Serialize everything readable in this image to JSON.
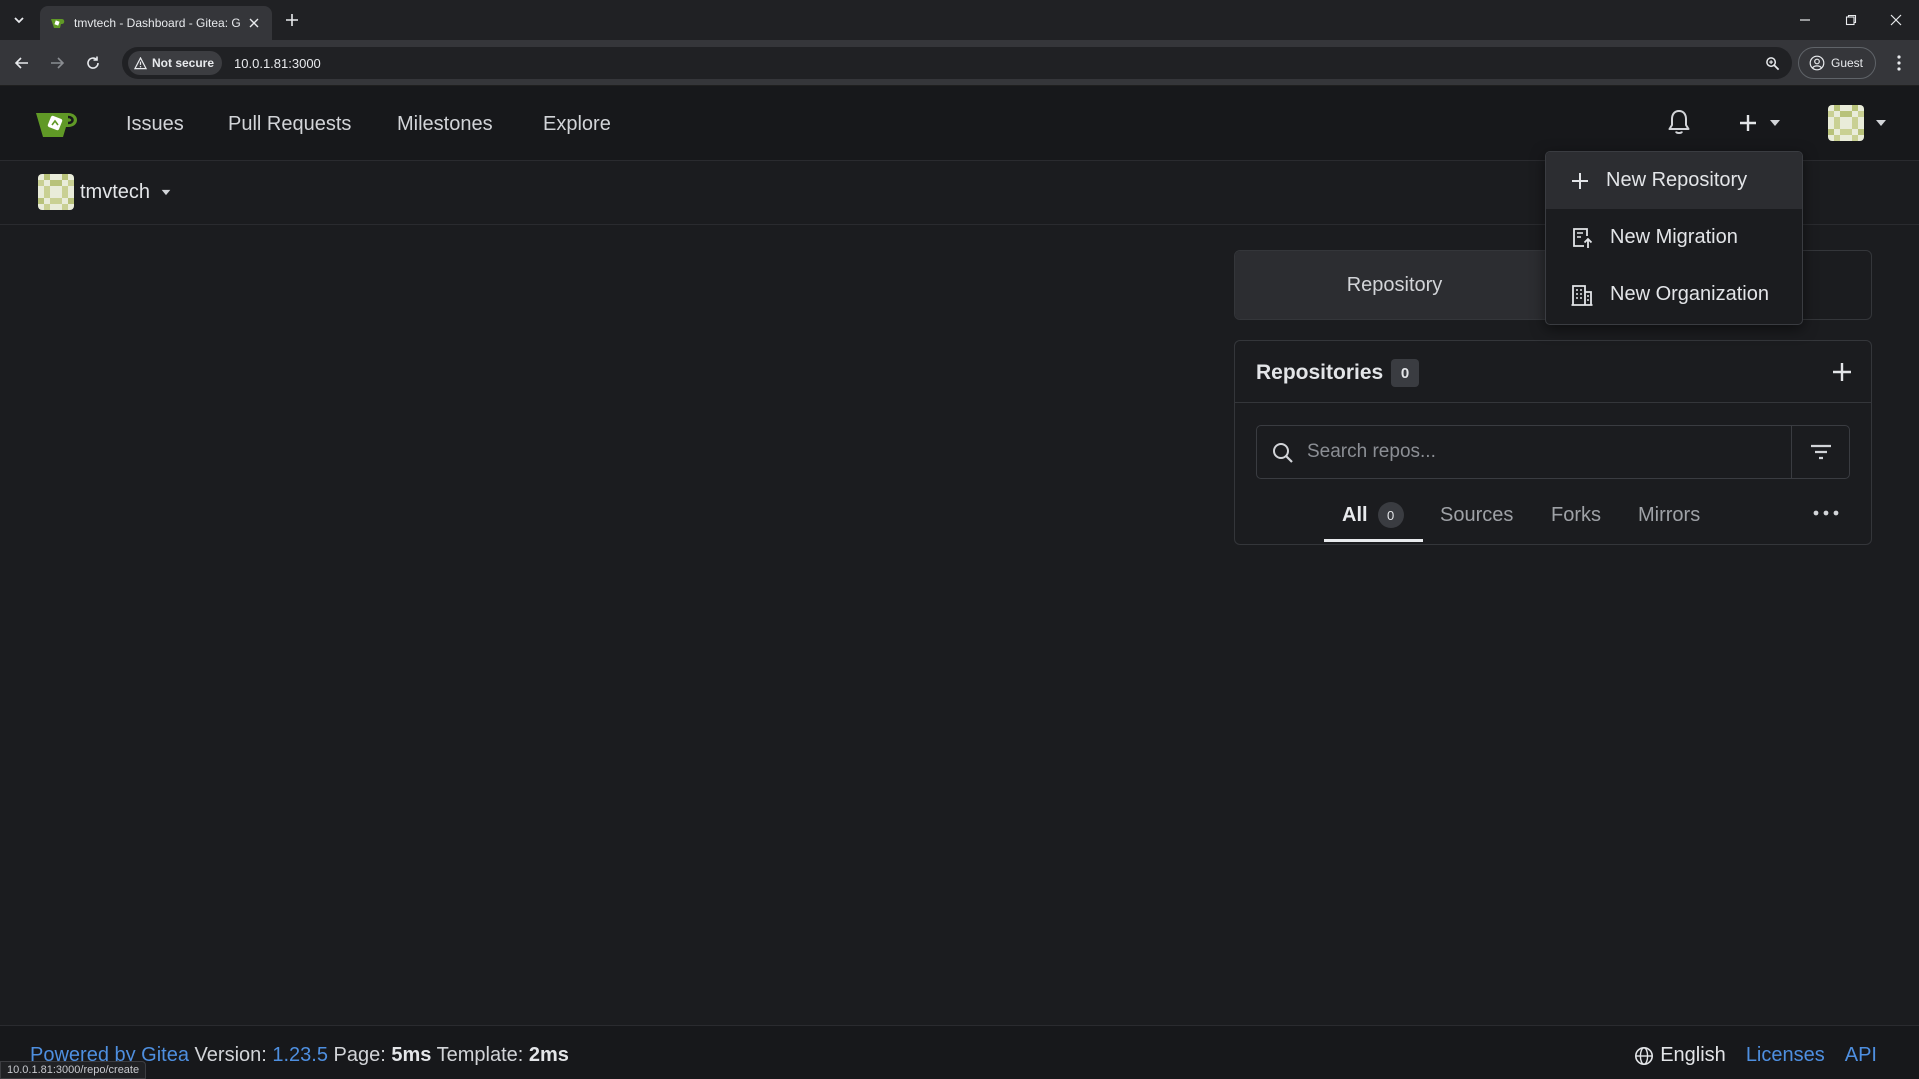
{
  "browser": {
    "tab_title": "tmvtech - Dashboard - Gitea: G",
    "security_label": "Not secure",
    "url": "10.0.1.81:3000",
    "profile_label": "Guest",
    "status_url": "10.0.1.81:3000/repo/create"
  },
  "navbar": {
    "links": [
      "Issues",
      "Pull Requests",
      "Milestones",
      "Explore"
    ]
  },
  "context": {
    "user": "tmvtech"
  },
  "dropdown": {
    "items": [
      "New Repository",
      "New Migration",
      "New Organization"
    ]
  },
  "panel": {
    "tab_repository": "Repository",
    "repos_title": "Repositories",
    "repos_count": "0",
    "search_placeholder": "Search repos...",
    "filters": {
      "all": "All",
      "all_count": "0",
      "sources": "Sources",
      "forks": "Forks",
      "mirrors": "Mirrors"
    }
  },
  "footer": {
    "powered_by": "Powered by Gitea",
    "version_label": "Version:",
    "version": "1.23.5",
    "page_label": "Page:",
    "page_time": "5ms",
    "template_label": "Template:",
    "template_time": "2ms",
    "language": "English",
    "licenses": "Licenses",
    "api": "API"
  },
  "colors": {
    "background": "#1b1c1f",
    "navbar": "#17181b",
    "link": "#4e8fe0",
    "gitea_green": "#609926"
  },
  "icons": {
    "bell": "bell-icon",
    "plus": "plus-icon",
    "search": "search-icon",
    "filter": "filter-icon",
    "more": "kebab-horizontal-icon",
    "globe": "globe-icon",
    "migration": "repo-push-icon",
    "organization": "organization-icon"
  }
}
